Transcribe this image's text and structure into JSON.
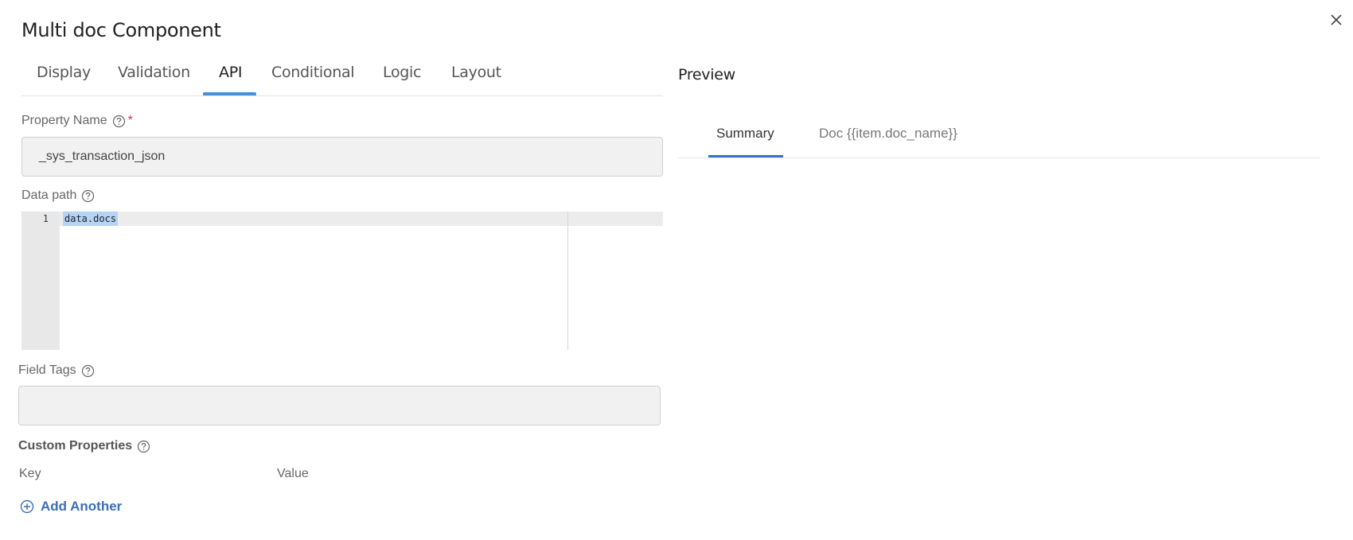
{
  "dialog": {
    "title": "Multi doc Component",
    "close_icon": "close-icon"
  },
  "tabs": [
    {
      "label": "Display",
      "active": false
    },
    {
      "label": "Validation",
      "active": false
    },
    {
      "label": "API",
      "active": true
    },
    {
      "label": "Conditional",
      "active": false
    },
    {
      "label": "Logic",
      "active": false
    },
    {
      "label": "Layout",
      "active": false
    }
  ],
  "property_name": {
    "label": "Property Name",
    "required_marker": "*",
    "value": "_sys_transaction_json"
  },
  "data_path": {
    "label": "Data path",
    "line_number": "1",
    "code": "data.docs"
  },
  "field_tags": {
    "label": "Field Tags",
    "value": ""
  },
  "custom_properties": {
    "label": "Custom Properties",
    "key_header": "Key",
    "value_header": "Value",
    "add_label": "Add Another"
  },
  "preview": {
    "title": "Preview",
    "tabs": [
      {
        "label": "Summary",
        "active": true
      },
      {
        "label": "Doc {{item.doc_name}}",
        "active": false
      }
    ]
  },
  "colors": {
    "accent": "#4a8fd6",
    "link": "#3c6fb6",
    "required": "#dd3333",
    "selection": "#b4d3f5"
  }
}
